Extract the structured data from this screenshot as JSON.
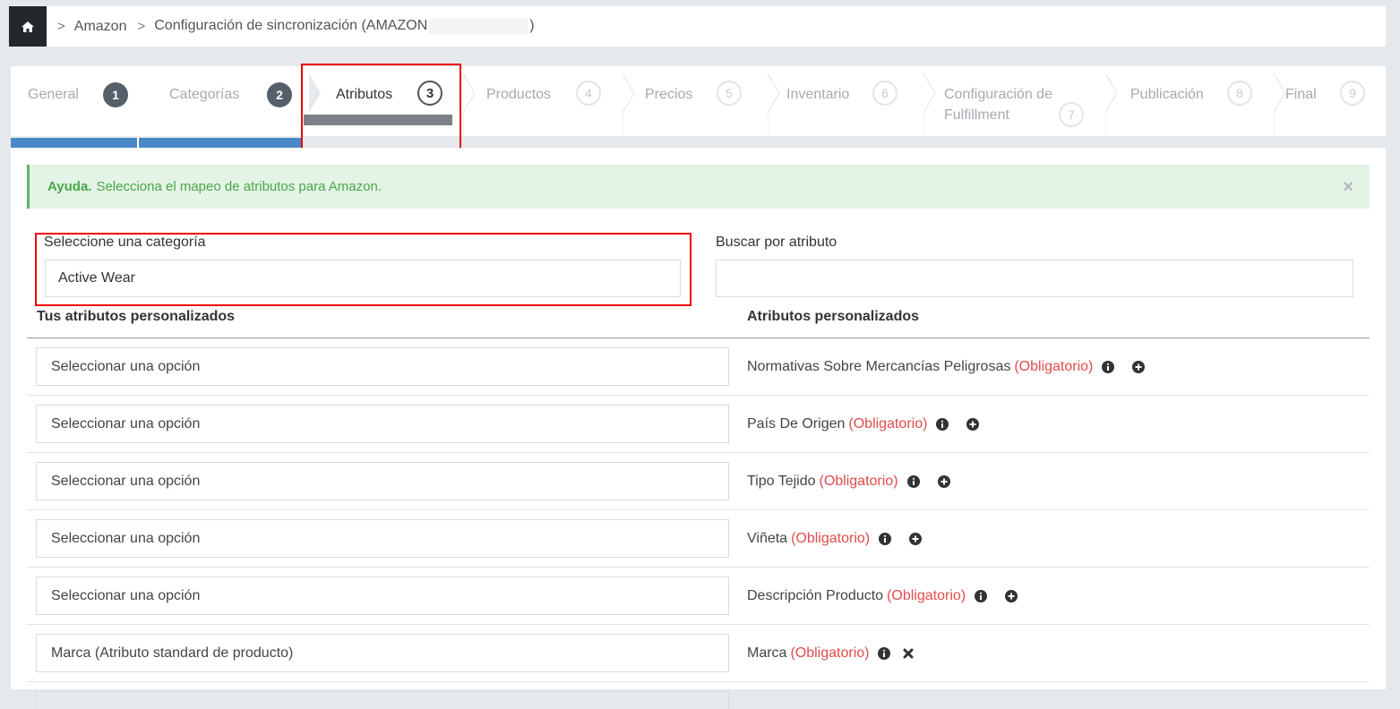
{
  "breadcrumb": {
    "items": [
      "Amazon",
      "Configuración de sincronización (AMAZON"
    ],
    "suffix": ")"
  },
  "wizard": {
    "steps": [
      {
        "label": "General",
        "num": "1",
        "state": "done"
      },
      {
        "label": "Categorías",
        "num": "2",
        "state": "done"
      },
      {
        "label": "Atributos",
        "num": "3",
        "state": "active"
      },
      {
        "label": "Productos",
        "num": "4",
        "state": "todo"
      },
      {
        "label": "Precios",
        "num": "5",
        "state": "todo"
      },
      {
        "label": "Inventario",
        "num": "6",
        "state": "todo"
      },
      {
        "label": "Configuración de",
        "label2": "Fulfillment",
        "num": "7",
        "state": "todo"
      },
      {
        "label": "Publicación",
        "num": "8",
        "state": "todo"
      },
      {
        "label": "Final",
        "num": "9",
        "state": "todo"
      }
    ]
  },
  "help": {
    "title": "Ayuda.",
    "text": "Selecciona el mapeo de atributos para Amazon.",
    "close": "×"
  },
  "category": {
    "label": "Seleccione una categoría",
    "value": "Active Wear"
  },
  "search": {
    "label": "Buscar por atributo",
    "value": ""
  },
  "columns": {
    "left": "Tus atributos personalizados",
    "right": "Atributos personalizados"
  },
  "rows": [
    {
      "select": "Seleccionar una opción",
      "attr": "Normativas Sobre Mercancías Peligrosas",
      "req": "(Obligatorio)",
      "action": "plus"
    },
    {
      "select": "Seleccionar una opción",
      "attr": "País De Origen",
      "req": "(Obligatorio)",
      "action": "plus"
    },
    {
      "select": "Seleccionar una opción",
      "attr": "Tipo Tejido",
      "req": "(Obligatorio)",
      "action": "plus"
    },
    {
      "select": "Seleccionar una opción",
      "attr": "Viñeta",
      "req": "(Obligatorio)",
      "action": "plus"
    },
    {
      "select": "Seleccionar una opción",
      "attr": "Descripción Producto",
      "req": "(Obligatorio)",
      "action": "plus"
    },
    {
      "select": "Marca (Atributo standard de producto)",
      "attr": "Marca",
      "req": "(Obligatorio)",
      "action": "remove"
    }
  ],
  "colors": {
    "accent": "#4a89c8",
    "required": "#e04b4b",
    "help_bg": "#e3f3e5",
    "help_text": "#4aa64a",
    "highlight": "#ee0000"
  }
}
